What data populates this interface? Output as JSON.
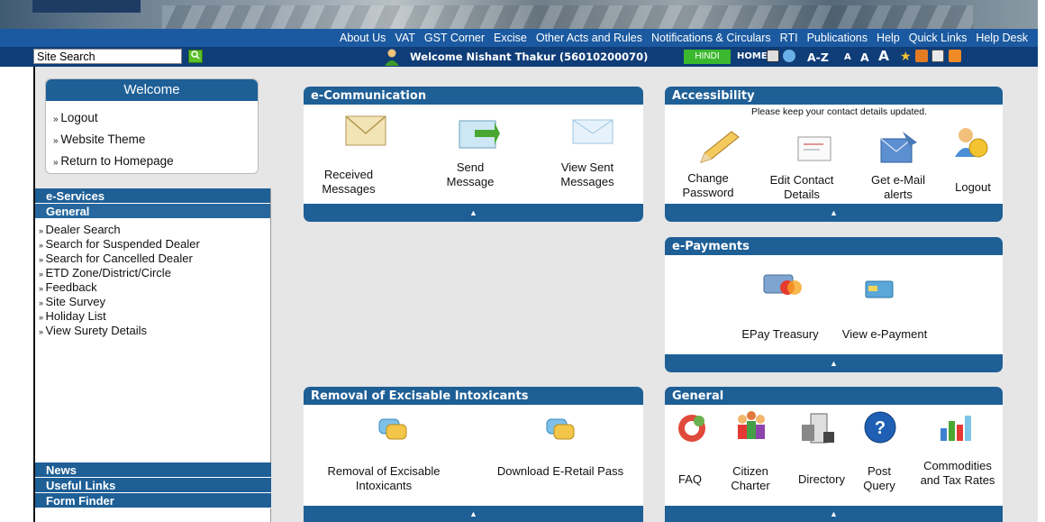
{
  "nav": [
    "About Us",
    "VAT",
    "GST Corner",
    "Excise",
    "Other Acts and Rules",
    "Notifications & Circulars",
    "RTI",
    "Publications",
    "Help",
    "Quick Links",
    "Help Desk"
  ],
  "search": {
    "value": "Site Search"
  },
  "user": {
    "welcome": "Welcome Nishant Thakur (56010200070)"
  },
  "toolbar": {
    "hindi": "HINDI",
    "home": "HOME",
    "az": "A-Z",
    "a_small": "A",
    "a_mid": "A",
    "a_big": "A"
  },
  "welcome_box": {
    "title": "Welcome",
    "items": [
      "Logout",
      "Website Theme",
      "Return to Homepage"
    ]
  },
  "sidebar": {
    "eservices": "e-Services",
    "general": "General",
    "items": [
      "Dealer Search",
      "Search for Suspended Dealer",
      "Search for Cancelled Dealer",
      "ETD Zone/District/Circle",
      "Feedback",
      "Site Survey",
      "Holiday List",
      "View Surety Details"
    ],
    "news": "News",
    "useful_links": "Useful Links",
    "form_finder": "Form Finder"
  },
  "ecomm": {
    "title": "e-Communication",
    "items": [
      "Received Messages",
      "Send Message",
      "View Sent Messages"
    ]
  },
  "access": {
    "title": "Accessibility",
    "note": "Please keep your contact details updated.",
    "items": [
      "Change Password",
      "Edit Contact Details",
      "Get e-Mail alerts",
      "Logout"
    ]
  },
  "epay": {
    "title": "e-Payments",
    "items": [
      "EPay Treasury",
      "View e-Payment"
    ]
  },
  "removal": {
    "title": "Removal of Excisable Intoxicants",
    "items": [
      "Removal of Excisable Intoxicants",
      "Download E-Retail Pass"
    ]
  },
  "general": {
    "title": "General",
    "items": [
      "FAQ",
      "Citizen Charter",
      "Directory",
      "Post Query",
      "Commodities and Tax Rates"
    ]
  },
  "arrow": "▲"
}
